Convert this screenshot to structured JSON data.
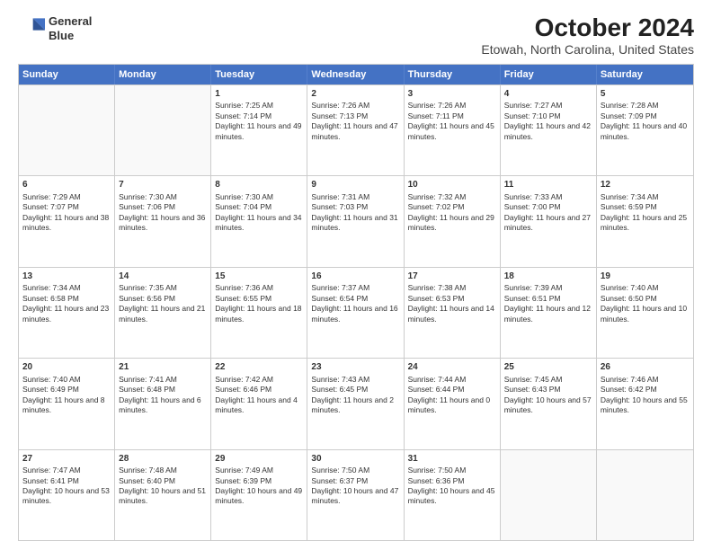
{
  "header": {
    "logo_line1": "General",
    "logo_line2": "Blue",
    "title": "October 2024",
    "subtitle": "Etowah, North Carolina, United States"
  },
  "days_of_week": [
    "Sunday",
    "Monday",
    "Tuesday",
    "Wednesday",
    "Thursday",
    "Friday",
    "Saturday"
  ],
  "weeks": [
    [
      {
        "day": "",
        "empty": true
      },
      {
        "day": "",
        "empty": true
      },
      {
        "day": "1",
        "sunrise": "7:25 AM",
        "sunset": "7:14 PM",
        "daylight": "11 hours and 49 minutes."
      },
      {
        "day": "2",
        "sunrise": "7:26 AM",
        "sunset": "7:13 PM",
        "daylight": "11 hours and 47 minutes."
      },
      {
        "day": "3",
        "sunrise": "7:26 AM",
        "sunset": "7:11 PM",
        "daylight": "11 hours and 45 minutes."
      },
      {
        "day": "4",
        "sunrise": "7:27 AM",
        "sunset": "7:10 PM",
        "daylight": "11 hours and 42 minutes."
      },
      {
        "day": "5",
        "sunrise": "7:28 AM",
        "sunset": "7:09 PM",
        "daylight": "11 hours and 40 minutes."
      }
    ],
    [
      {
        "day": "6",
        "sunrise": "7:29 AM",
        "sunset": "7:07 PM",
        "daylight": "11 hours and 38 minutes."
      },
      {
        "day": "7",
        "sunrise": "7:30 AM",
        "sunset": "7:06 PM",
        "daylight": "11 hours and 36 minutes."
      },
      {
        "day": "8",
        "sunrise": "7:30 AM",
        "sunset": "7:04 PM",
        "daylight": "11 hours and 34 minutes."
      },
      {
        "day": "9",
        "sunrise": "7:31 AM",
        "sunset": "7:03 PM",
        "daylight": "11 hours and 31 minutes."
      },
      {
        "day": "10",
        "sunrise": "7:32 AM",
        "sunset": "7:02 PM",
        "daylight": "11 hours and 29 minutes."
      },
      {
        "day": "11",
        "sunrise": "7:33 AM",
        "sunset": "7:00 PM",
        "daylight": "11 hours and 27 minutes."
      },
      {
        "day": "12",
        "sunrise": "7:34 AM",
        "sunset": "6:59 PM",
        "daylight": "11 hours and 25 minutes."
      }
    ],
    [
      {
        "day": "13",
        "sunrise": "7:34 AM",
        "sunset": "6:58 PM",
        "daylight": "11 hours and 23 minutes."
      },
      {
        "day": "14",
        "sunrise": "7:35 AM",
        "sunset": "6:56 PM",
        "daylight": "11 hours and 21 minutes."
      },
      {
        "day": "15",
        "sunrise": "7:36 AM",
        "sunset": "6:55 PM",
        "daylight": "11 hours and 18 minutes."
      },
      {
        "day": "16",
        "sunrise": "7:37 AM",
        "sunset": "6:54 PM",
        "daylight": "11 hours and 16 minutes."
      },
      {
        "day": "17",
        "sunrise": "7:38 AM",
        "sunset": "6:53 PM",
        "daylight": "11 hours and 14 minutes."
      },
      {
        "day": "18",
        "sunrise": "7:39 AM",
        "sunset": "6:51 PM",
        "daylight": "11 hours and 12 minutes."
      },
      {
        "day": "19",
        "sunrise": "7:40 AM",
        "sunset": "6:50 PM",
        "daylight": "11 hours and 10 minutes."
      }
    ],
    [
      {
        "day": "20",
        "sunrise": "7:40 AM",
        "sunset": "6:49 PM",
        "daylight": "11 hours and 8 minutes."
      },
      {
        "day": "21",
        "sunrise": "7:41 AM",
        "sunset": "6:48 PM",
        "daylight": "11 hours and 6 minutes."
      },
      {
        "day": "22",
        "sunrise": "7:42 AM",
        "sunset": "6:46 PM",
        "daylight": "11 hours and 4 minutes."
      },
      {
        "day": "23",
        "sunrise": "7:43 AM",
        "sunset": "6:45 PM",
        "daylight": "11 hours and 2 minutes."
      },
      {
        "day": "24",
        "sunrise": "7:44 AM",
        "sunset": "6:44 PM",
        "daylight": "11 hours and 0 minutes."
      },
      {
        "day": "25",
        "sunrise": "7:45 AM",
        "sunset": "6:43 PM",
        "daylight": "10 hours and 57 minutes."
      },
      {
        "day": "26",
        "sunrise": "7:46 AM",
        "sunset": "6:42 PM",
        "daylight": "10 hours and 55 minutes."
      }
    ],
    [
      {
        "day": "27",
        "sunrise": "7:47 AM",
        "sunset": "6:41 PM",
        "daylight": "10 hours and 53 minutes."
      },
      {
        "day": "28",
        "sunrise": "7:48 AM",
        "sunset": "6:40 PM",
        "daylight": "10 hours and 51 minutes."
      },
      {
        "day": "29",
        "sunrise": "7:49 AM",
        "sunset": "6:39 PM",
        "daylight": "10 hours and 49 minutes."
      },
      {
        "day": "30",
        "sunrise": "7:50 AM",
        "sunset": "6:37 PM",
        "daylight": "10 hours and 47 minutes."
      },
      {
        "day": "31",
        "sunrise": "7:50 AM",
        "sunset": "6:36 PM",
        "daylight": "10 hours and 45 minutes."
      },
      {
        "day": "",
        "empty": true
      },
      {
        "day": "",
        "empty": true
      }
    ]
  ]
}
